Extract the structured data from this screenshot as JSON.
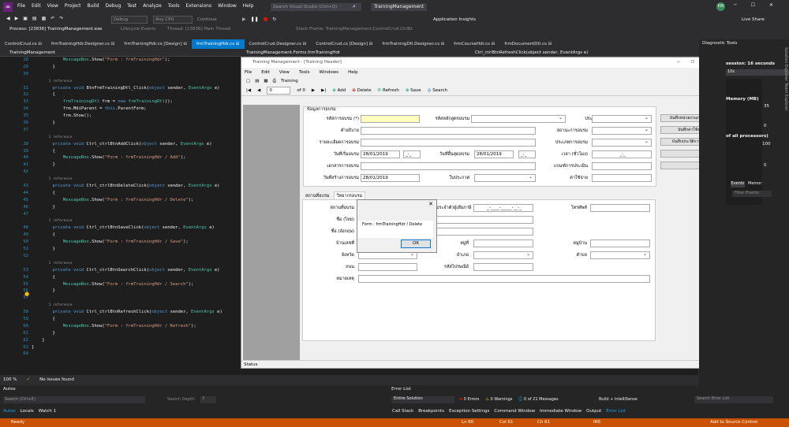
{
  "titlebar": {
    "menu": [
      "File",
      "Edit",
      "View",
      "Project",
      "Build",
      "Debug",
      "Test",
      "Analyze",
      "Tools",
      "Extensions",
      "Window",
      "Help"
    ],
    "search_placeholder": "Search Visual Studio (Ctrl+Q)",
    "solution_name": "TrainingManagement",
    "avatar_initials": "KW"
  },
  "toolbar": {
    "config": "Debug",
    "platform": "Any CPU",
    "continue": "Continue",
    "app_insights": "Application Insights",
    "live_share": "Live Share"
  },
  "debugbar": {
    "process": "Process: [23836] TrainingManagement.exe",
    "lifecycle": "Lifecycle Events",
    "thread": "Thread: [13836] Main Thread",
    "stack": "Stack Frame: TrainingManagement.ControlCrud.CtrlBt"
  },
  "tabs": [
    {
      "label": "ControlCrud.cs",
      "active": false
    },
    {
      "label": "frmTrainingHdr.Designer.cs",
      "active": false
    },
    {
      "label": "frmTrainingHdr.cs [Design]",
      "active": false
    },
    {
      "label": "frmTrainingHdr.cs",
      "active": true
    },
    {
      "label": "ControlCrud.Designer.cs",
      "active": false
    },
    {
      "label": "ControlCrud.cs [Design]",
      "active": false
    },
    {
      "label": "frmTrainingDtl.Designer.cs",
      "active": false
    },
    {
      "label": "frmCourseHdr.cs",
      "active": false
    },
    {
      "label": "frmDocumentDtl.cs",
      "active": false
    }
  ],
  "navbar": {
    "project": "TrainingManagement",
    "class": "TrainingManagement.Forms.frmTrainingHdr",
    "member": "Ctrl_ctrlBtnRefreshClick(object sender, EventArgs e)"
  },
  "code": [
    {
      "n": "28",
      "t": "            MessageBox.Show(\"Form : frmTrainingHdr\");"
    },
    {
      "n": "29",
      "t": "        }"
    },
    {
      "n": "30",
      "t": ""
    },
    {
      "n": "",
      "t": "        1 reference"
    },
    {
      "n": "31",
      "t": "        private void BtnFrmTrainingDtl_Click(object sender, EventArgs e)"
    },
    {
      "n": "32",
      "t": "        {"
    },
    {
      "n": "33",
      "t": "            frmTrainingDtl frm = new frmTrainingDtl();"
    },
    {
      "n": "34",
      "t": "            frm.MdiParent = this.ParentForm;"
    },
    {
      "n": "35",
      "t": "            frm.Show();"
    },
    {
      "n": "36",
      "t": "        }"
    },
    {
      "n": "37",
      "t": ""
    },
    {
      "n": "",
      "t": "        1 reference"
    },
    {
      "n": "38",
      "t": "        private void Ctrl_ctrlBtnAddClick(object sender, EventArgs e)"
    },
    {
      "n": "39",
      "t": "        {"
    },
    {
      "n": "40",
      "t": "            MessageBox.Show(\"Form : frmTrainingHdr / Add\");"
    },
    {
      "n": "41",
      "t": "        }"
    },
    {
      "n": "42",
      "t": ""
    },
    {
      "n": "",
      "t": "        1 reference"
    },
    {
      "n": "43",
      "t": "        private void Ctrl_ctrlBtnDeleteClick(object sender, EventArgs e)"
    },
    {
      "n": "44",
      "t": "        {"
    },
    {
      "n": "45",
      "t": "            MessageBox.Show(\"Form : frmTrainingHdr / Delete\");"
    },
    {
      "n": "46",
      "t": "        }"
    },
    {
      "n": "47",
      "t": ""
    },
    {
      "n": "",
      "t": "        1 reference"
    },
    {
      "n": "48",
      "t": "        private void Ctrl_ctrlBtnSaveClick(object sender, EventArgs e)"
    },
    {
      "n": "49",
      "t": "        {"
    },
    {
      "n": "50",
      "t": "            MessageBox.Show(\"Form : frmTrainingHdr / Save\");"
    },
    {
      "n": "51",
      "t": "        }"
    },
    {
      "n": "52",
      "t": ""
    },
    {
      "n": "",
      "t": "        1 reference"
    },
    {
      "n": "53",
      "t": "        private void Ctrl_ctrlBtnSearchClick(object sender, EventArgs e)"
    },
    {
      "n": "54",
      "t": "        {"
    },
    {
      "n": "55",
      "t": "            MessageBox.Show(\"Form : frmTrainingHdr / Search\");"
    },
    {
      "n": "56",
      "t": "        }"
    },
    {
      "n": "57",
      "t": ""
    },
    {
      "n": "",
      "t": "        1 reference"
    },
    {
      "n": "58",
      "t": "        private void Ctrl_ctrlBtnRefreshClick(object sender, EventArgs e)"
    },
    {
      "n": "59",
      "t": "        {"
    },
    {
      "n": "60",
      "t": "            MessageBox.Show(\"Form : frmTrainingHdr / Refresh\");"
    },
    {
      "n": "61",
      "t": "        }"
    },
    {
      "n": "62",
      "t": "    }"
    },
    {
      "n": "63",
      "t": "}"
    },
    {
      "n": "64",
      "t": ""
    }
  ],
  "winform": {
    "title": "Training Management - [Training Header]",
    "menu": [
      "File",
      "Edit",
      "View",
      "Tools",
      "Windows",
      "Help"
    ],
    "toolbar_label": "Training",
    "nav_pos": "0",
    "nav_of": "of 0",
    "buttons": {
      "add": "Add",
      "delete": "Delete",
      "refresh": "Refresh",
      "save": "Save",
      "search": "Search"
    },
    "group_title": "ข้อมูลการอบรม",
    "fields": {
      "course_code": "รหัสการอบรม (*)",
      "description": "คำอธิบาย",
      "detail": "รายละเอียดการอบรม",
      "start_date": "วันที่เริ่มอบรม",
      "start_value": "28/01/2019",
      "time_empty": "_:_",
      "doc": "เอกสารการอบรม",
      "create_date": "วันที่สร้างการอบรม",
      "create_value": "28/01/2019",
      "group_type": "รหัสหลักสูตรอบรม",
      "end_date": "วันที่สิ้นสุดอบรม",
      "end_value": "28/01/2019",
      "cert": "ใบประกาศ",
      "course_type": "ประเภทหลักสูตร",
      "status": "สถานะการอบรม",
      "train_type": "ประเภทการอบรม",
      "time": "เวลา (ชั่วโมง)",
      "time_value": "_:_",
      "eval": "เกณฑ์การประเมิน",
      "cost": "ค่าใช้จ่าย"
    },
    "side_buttons": [
      "บันทึกหน่วยงานเข้าอบรม",
      "บันทึกค่าใช้จ่าย",
      "บันทึกประวัติการอบรม"
    ],
    "tabs": [
      "สถานที่อบรม",
      "วิทยากรอบรม"
    ],
    "place": {
      "place_label": "สถานที่อบรม",
      "name_th": "ชื่อ (ไทย)",
      "name_en": "ชื่อ (อังกฤษ)",
      "house_no": "บ้านเลขที่",
      "province": "จังหวัด",
      "road": "ถนน",
      "note": "หมายเหตุ",
      "tax_id": "เลขประจำตัวผู้เสียภาษี",
      "tax_mask": "_-____-_____-__-_",
      "phone": "โทรศัพท์",
      "moo": "หมู่ที่",
      "district": "อำเภอ",
      "postcode": "รหัสไปรษณีย์",
      "village": "หมู่บ้าน",
      "subdistrict": "ตำบล"
    },
    "status": "Status",
    "dialog": {
      "message": "Form : frmTrainingHdr / Delete",
      "ok": "OK"
    }
  },
  "diagnostics": {
    "title": "Diagnostic Tools",
    "session": "session: 16 seconds",
    "time": "10s",
    "mem": "Memory (MB)",
    "mem_max": "35",
    "mem_min": "0",
    "cpu": "of all processors)",
    "cpu_max": "100",
    "cpu_min": "0",
    "tab_events": "Events",
    "tab_memory": "Memor",
    "filter": "Filter Events",
    "side_tabs": [
      "Solution Explorer",
      "Team Explorer"
    ]
  },
  "editor_status": {
    "zoom": "100 %",
    "issues": "No issues found"
  },
  "autos": {
    "title": "Autos",
    "search": "Search (Ctrl+E)",
    "depth": "Search Depth:",
    "depth_val": "3",
    "tabs": [
      "Autos",
      "Locals",
      "Watch 1"
    ]
  },
  "errorlist": {
    "title": "Error List",
    "scope": "Entire Solution",
    "errors": "0 Errors",
    "warnings": "0 Warnings",
    "messages": "0 of 21 Messages",
    "build": "Build + IntelliSense",
    "search": "Search Error List",
    "tabs": [
      "Call Stack",
      "Breakpoints",
      "Exception Settings",
      "Command Window",
      "Immediate Window",
      "Output",
      "Error List"
    ]
  },
  "statusbar": {
    "ready": "Ready",
    "ln": "Ln 60",
    "col": "Col 61",
    "ch": "Ch 61",
    "ins": "INS",
    "source": "Add to Source Control"
  }
}
